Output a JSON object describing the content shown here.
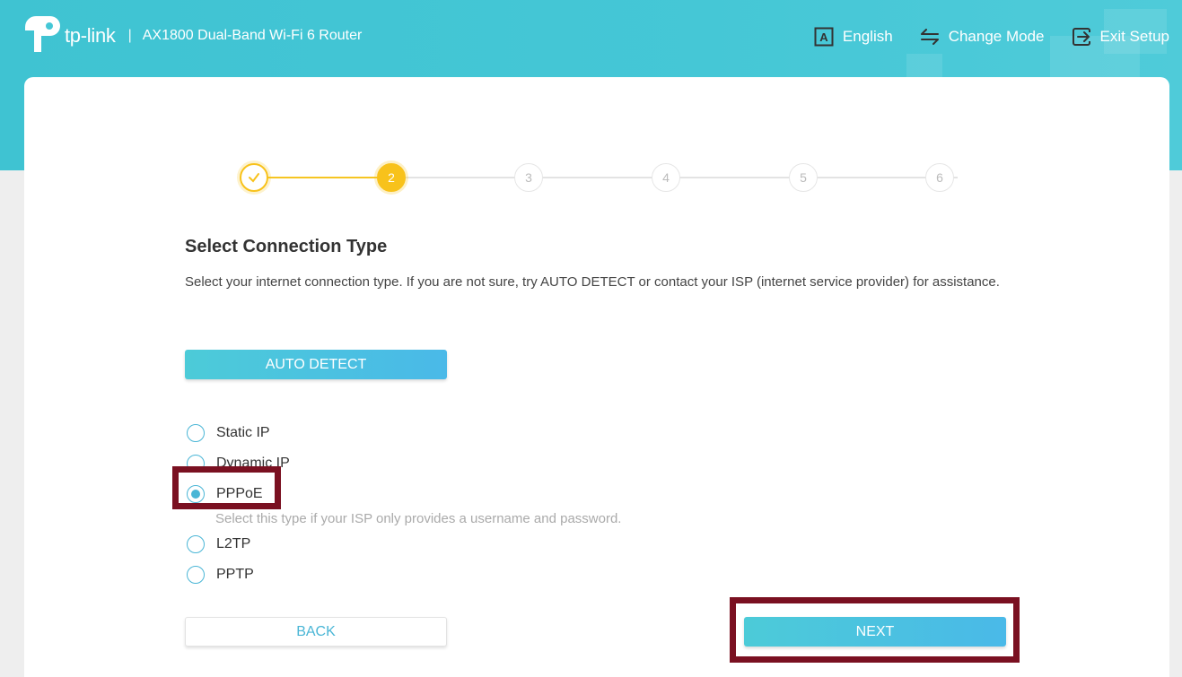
{
  "header": {
    "brand": "tp-link",
    "separator": "|",
    "product": "AX1800 Dual-Band Wi-Fi 6 Router",
    "actions": [
      {
        "label": "English",
        "icon": "language-icon"
      },
      {
        "label": "Change Mode",
        "icon": "change-mode-icon"
      },
      {
        "label": "Exit Setup",
        "icon": "exit-icon"
      }
    ]
  },
  "stepper": {
    "current": 2,
    "steps": [
      {
        "label": "",
        "state": "complete"
      },
      {
        "label": "2",
        "state": "current"
      },
      {
        "label": "3",
        "state": "pending"
      },
      {
        "label": "4",
        "state": "pending"
      },
      {
        "label": "5",
        "state": "pending"
      },
      {
        "label": "6",
        "state": "pending"
      }
    ]
  },
  "main": {
    "title": "Select Connection Type",
    "description": "Select your internet connection type. If you are not sure, try AUTO DETECT or contact your ISP (internet service provider) for assistance.",
    "auto_detect_label": "AUTO DETECT",
    "options": [
      {
        "label": "Static IP",
        "checked": false
      },
      {
        "label": "Dynamic IP",
        "checked": false
      },
      {
        "label": "PPPoE",
        "checked": true
      },
      {
        "label": "L2TP",
        "checked": false
      },
      {
        "label": "PPTP",
        "checked": false
      }
    ],
    "pppoe_hint": "Select this type if your ISP only provides a username and password.",
    "back_label": "BACK",
    "next_label": "NEXT"
  },
  "colors": {
    "header": "#45c7d6",
    "accent": "#4ab6d6",
    "step_active": "#f8c21b",
    "highlight": "#7a1021"
  }
}
